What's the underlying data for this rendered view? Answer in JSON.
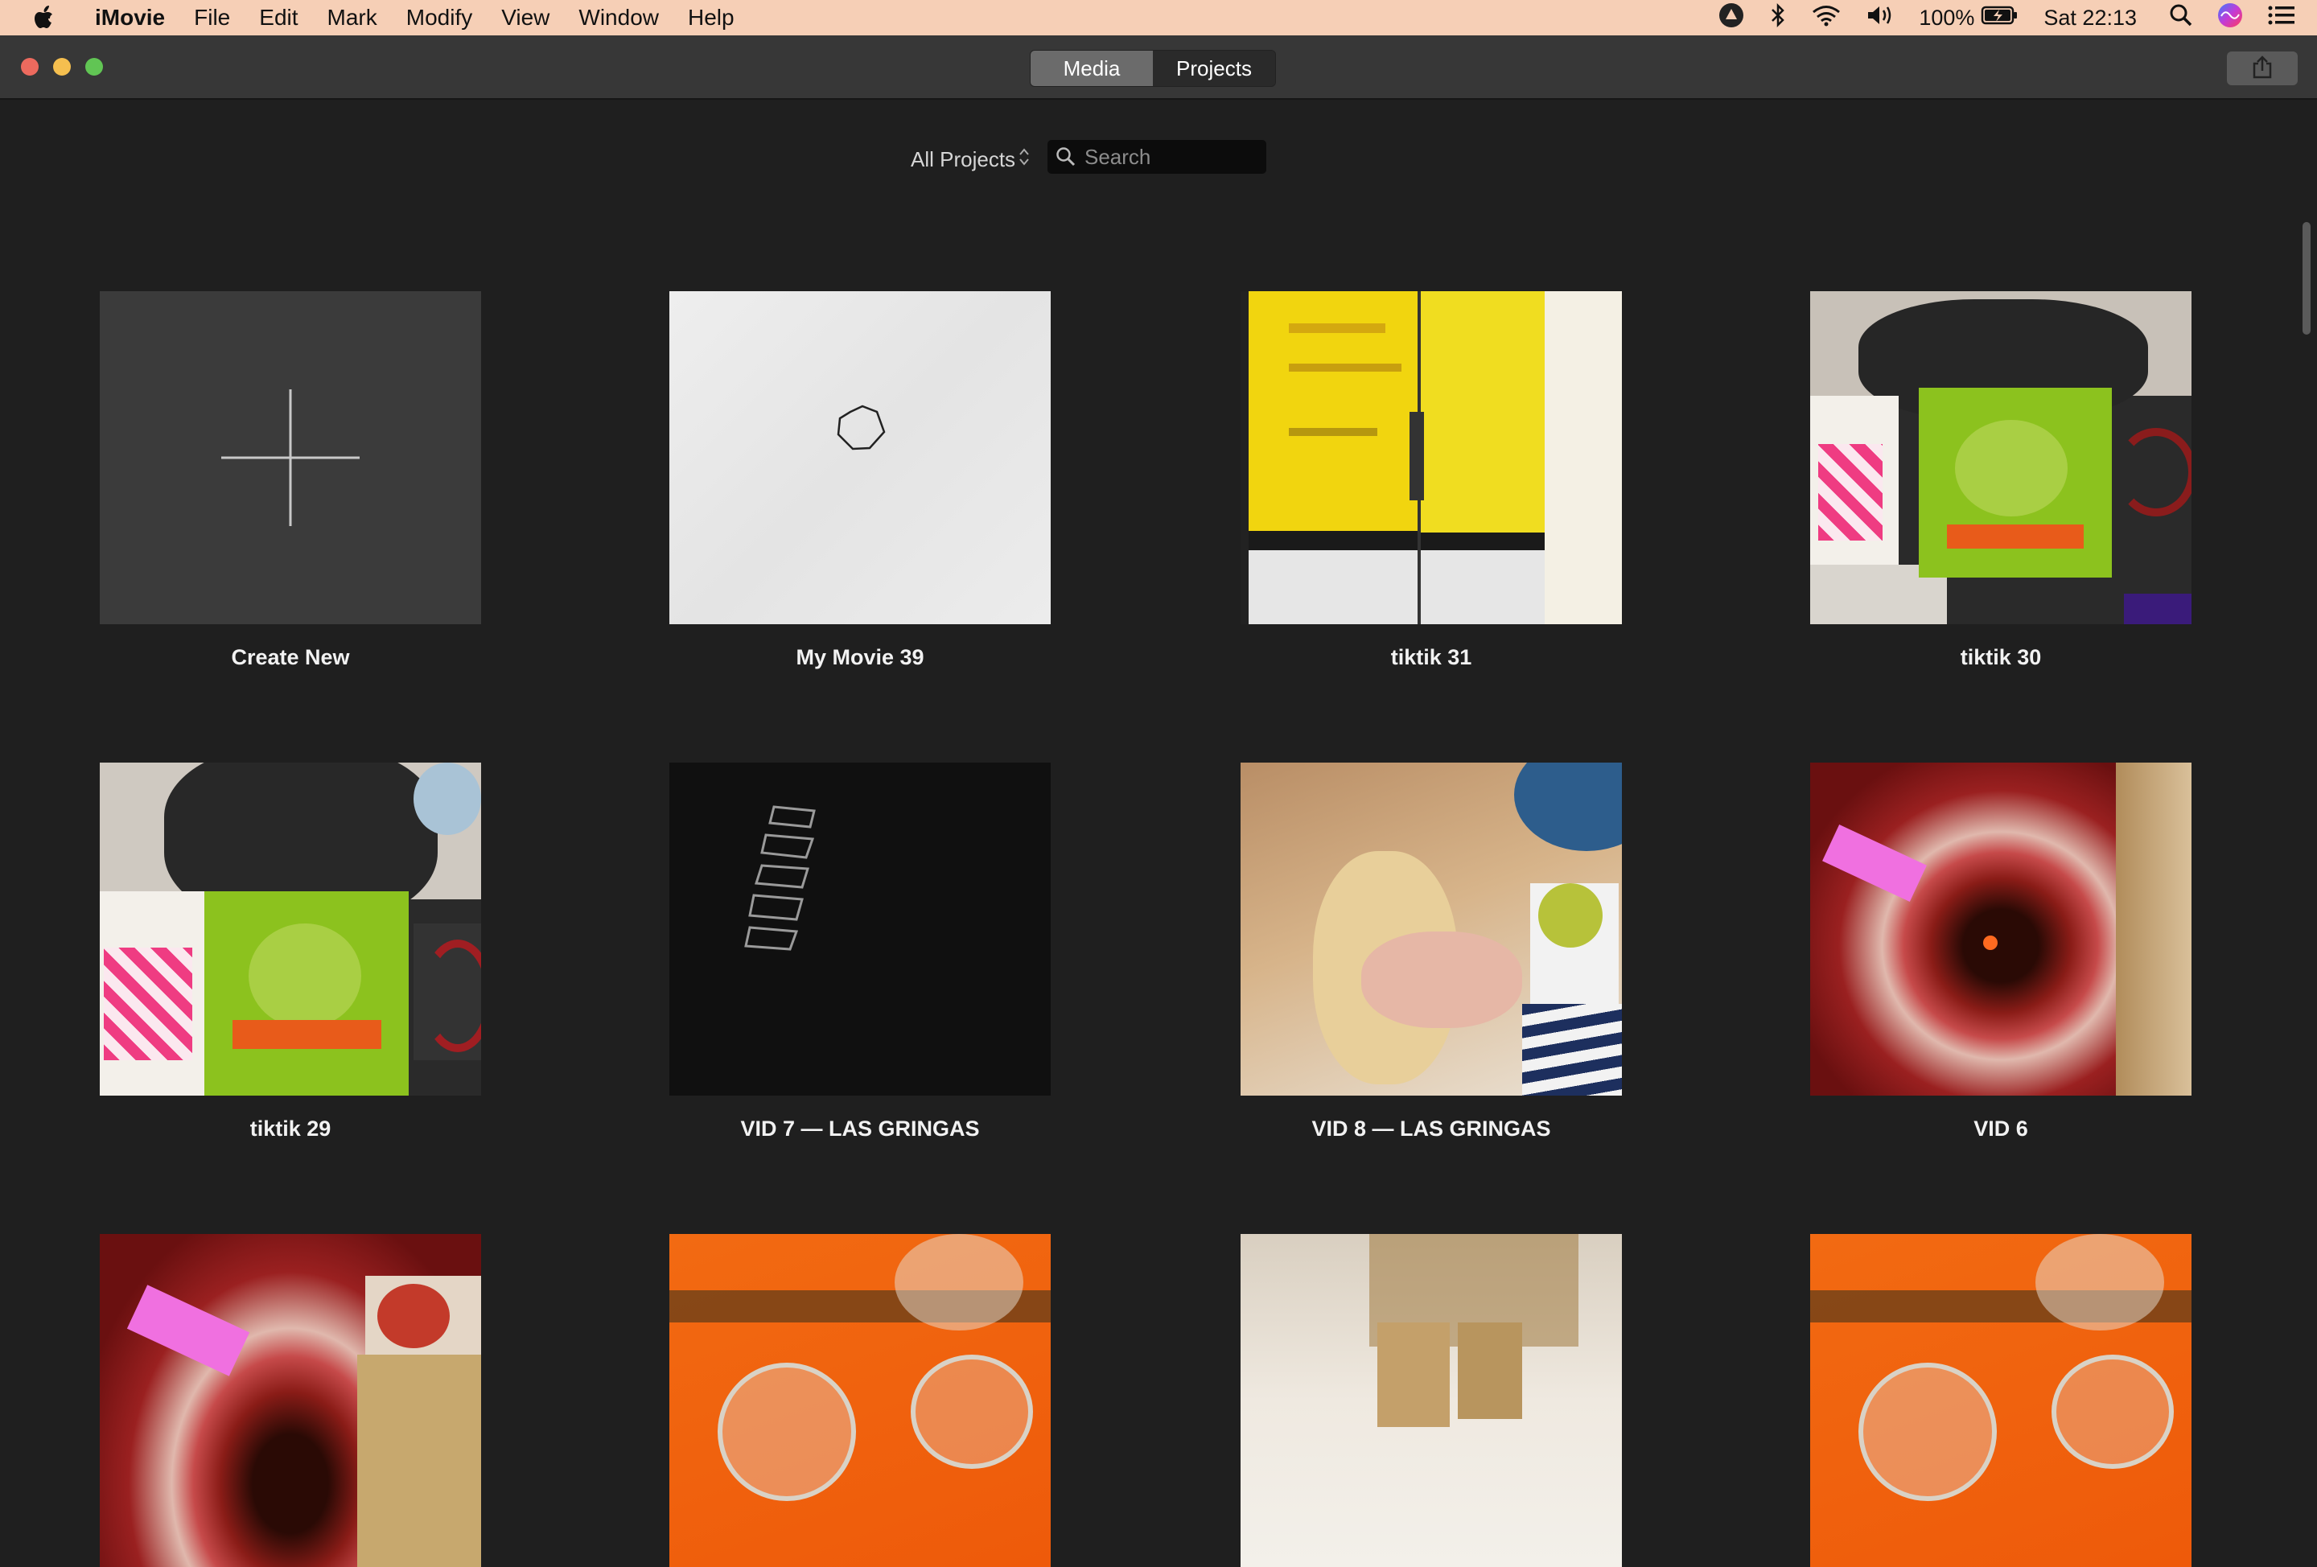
{
  "menubar": {
    "app_name": "iMovie",
    "items": [
      "File",
      "Edit",
      "Mark",
      "Modify",
      "View",
      "Window",
      "Help"
    ],
    "battery": "100%",
    "clock": "Sat 22:13",
    "icons": [
      "apple-logo-icon",
      "creative-cloud-icon",
      "bluetooth-icon",
      "wifi-icon",
      "volume-icon",
      "battery-icon",
      "spotlight-search-icon",
      "siri-icon",
      "notification-center-icon"
    ]
  },
  "toolbar": {
    "segments": [
      "Media",
      "Projects"
    ],
    "selected_segment": "Media",
    "share_icon": "share-icon"
  },
  "browser": {
    "filter_label": "All Projects",
    "search_placeholder": "Search",
    "search_value": ""
  },
  "projects": [
    {
      "label": "Create New"
    },
    {
      "label": "My Movie 39"
    },
    {
      "label": "tiktik 31"
    },
    {
      "label": "tiktik 30"
    },
    {
      "label": "tiktik 29"
    },
    {
      "label": "VID 7 — LAS GRINGAS"
    },
    {
      "label": "VID 8 — LAS GRINGAS"
    },
    {
      "label": "VID 6"
    },
    {
      "label": ""
    },
    {
      "label": ""
    },
    {
      "label": ""
    },
    {
      "label": ""
    }
  ],
  "colors": {
    "menubar_bg": "#f6cfb6",
    "toolbar_bg": "#373737",
    "content_bg": "#1f1f1f",
    "close": "#ed6a5e",
    "minimize": "#f5bf4f",
    "zoom": "#61c554"
  }
}
